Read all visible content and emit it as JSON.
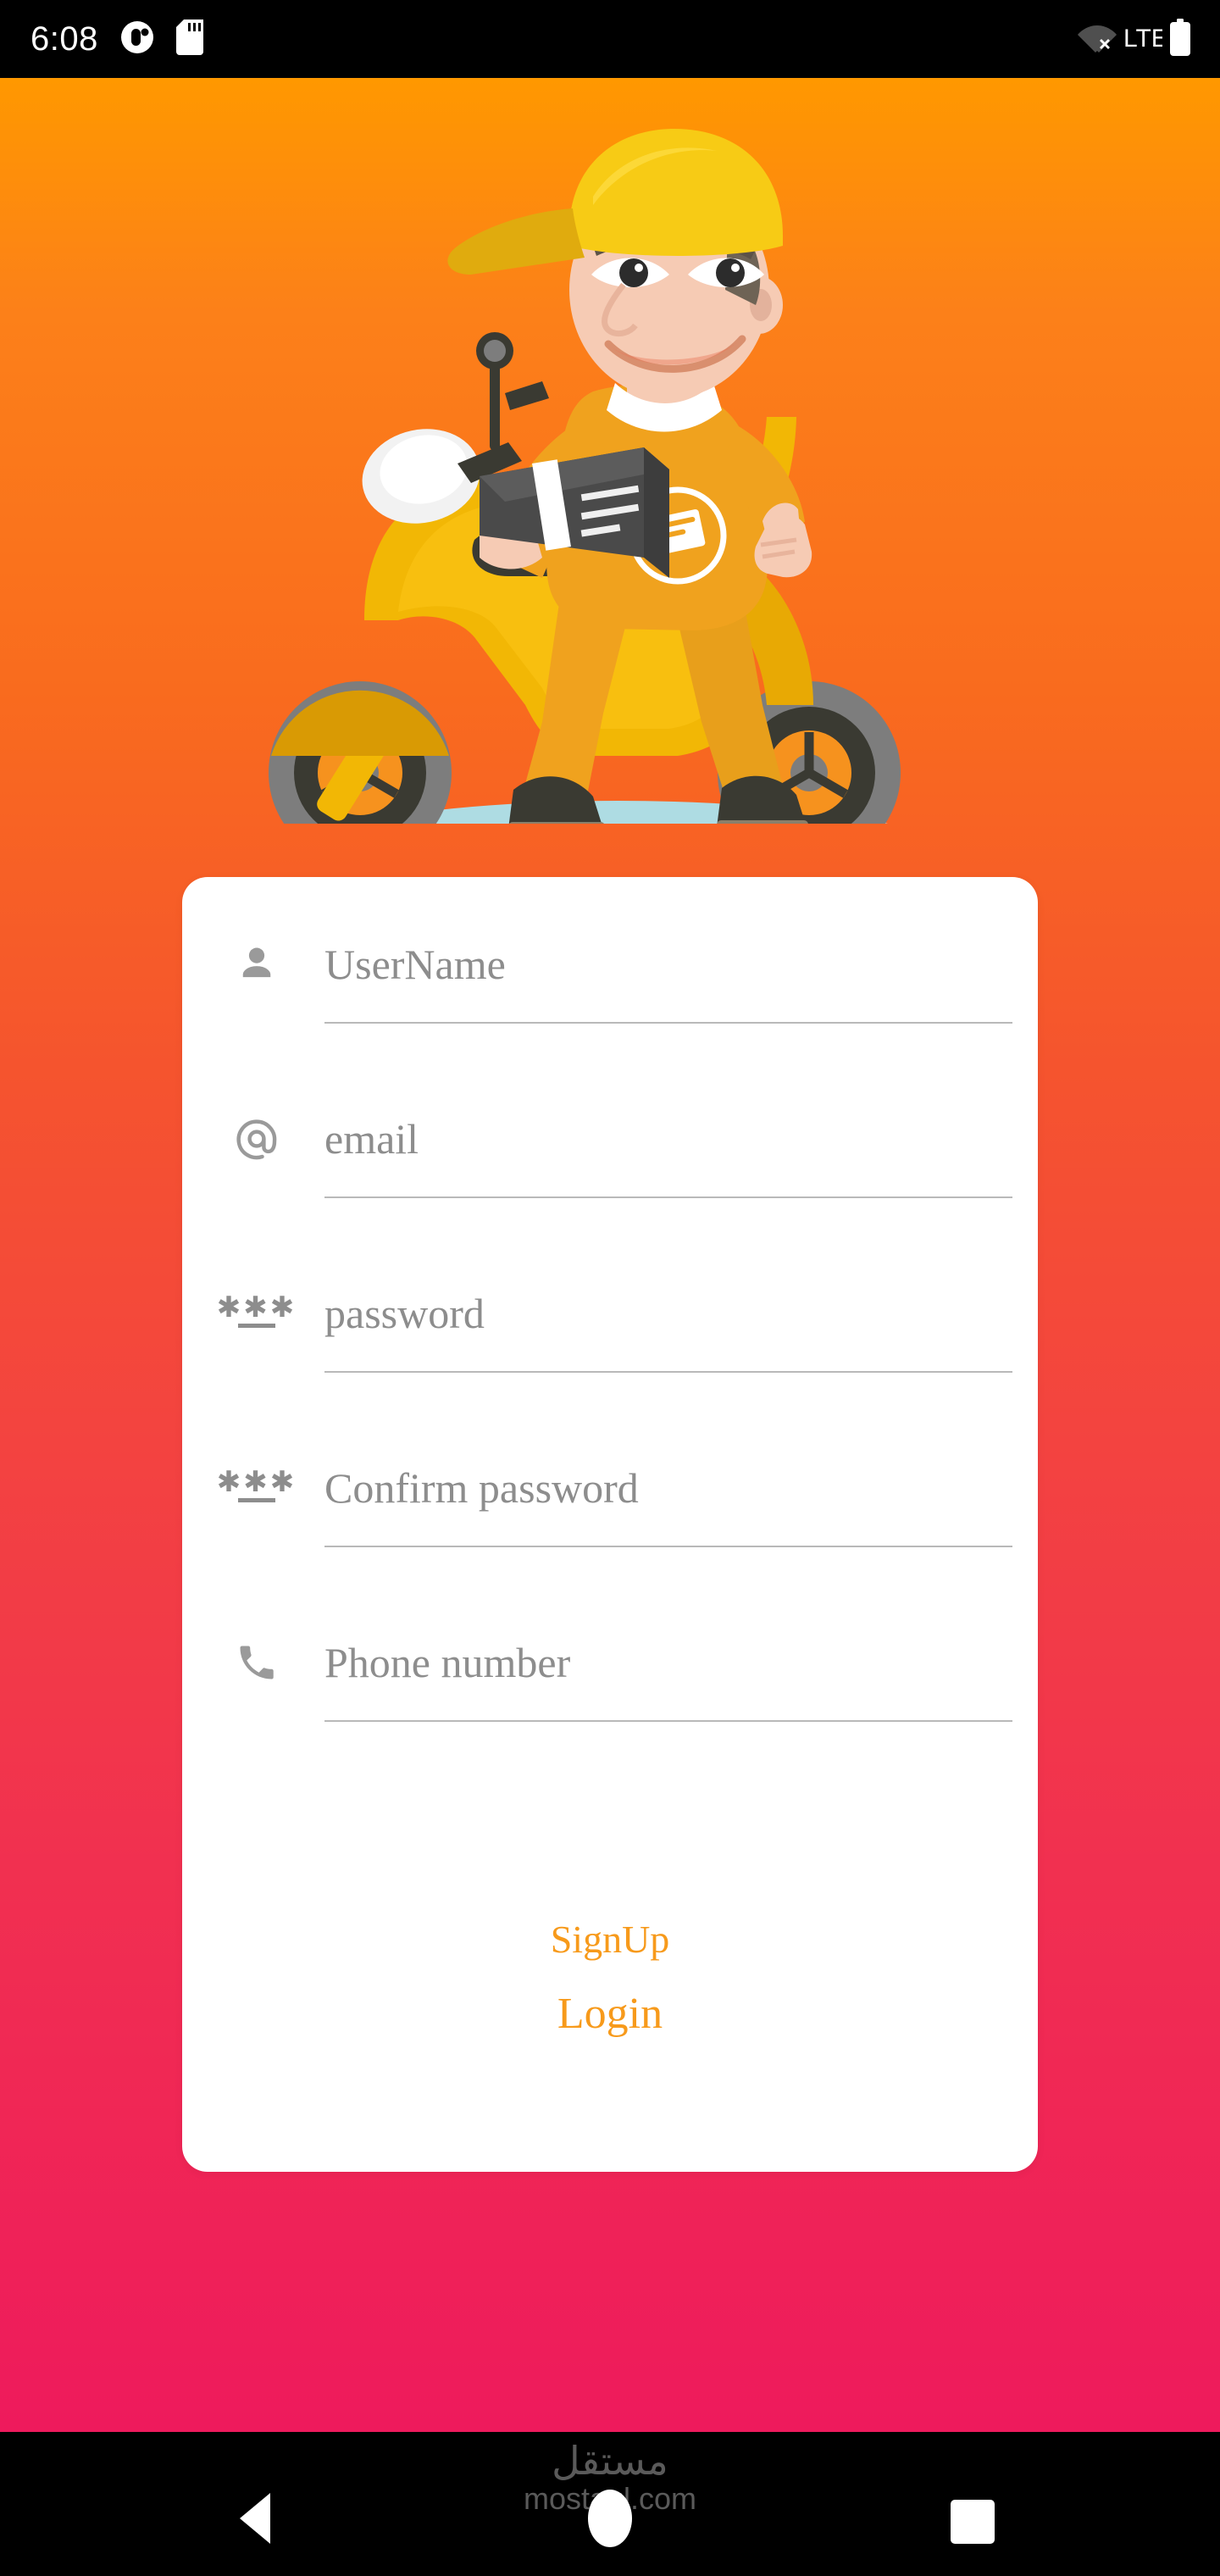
{
  "statusbar": {
    "clock": "6:08",
    "left_icons": [
      {
        "name": "app-notification-icon"
      },
      {
        "name": "sd-card-icon"
      }
    ],
    "network_label": "LTE",
    "right_icons": [
      {
        "name": "wifi-off-icon"
      },
      {
        "name": "battery-icon"
      }
    ]
  },
  "illustration": {
    "name": "delivery-man-on-scooter-illustration",
    "colors": {
      "scooter_yellow": "#F2B705",
      "scooter_yellow_dark": "#D99A04",
      "shirt_orange": "#F0A21E",
      "skin": "#F6CBB4",
      "dark": "#3A3A32",
      "box_gray": "#4A4A4A",
      "shadow_blue": "#AEDCE3"
    }
  },
  "background": {
    "gradient_top": "#FF9800",
    "gradient_bottom": "#EE1A5C"
  },
  "card": {
    "fields": [
      {
        "icon": "person-icon",
        "placeholder": "UserName",
        "value": ""
      },
      {
        "icon": "at-sign-icon",
        "placeholder": "email",
        "value": ""
      },
      {
        "icon": "password-icon",
        "placeholder": "password",
        "value": ""
      },
      {
        "icon": "password-icon",
        "placeholder": "Confirm password",
        "value": ""
      },
      {
        "icon": "phone-icon",
        "placeholder": "Phone number",
        "value": ""
      }
    ],
    "signup_label": "SignUp",
    "login_label": "Login",
    "accent_color": "#F79A1B"
  },
  "navbar": {
    "back_label": "Back",
    "home_label": "Home",
    "recents_label": "Recents"
  },
  "watermark": {
    "arabic": "مستقل",
    "latin": "mostaql.com"
  }
}
